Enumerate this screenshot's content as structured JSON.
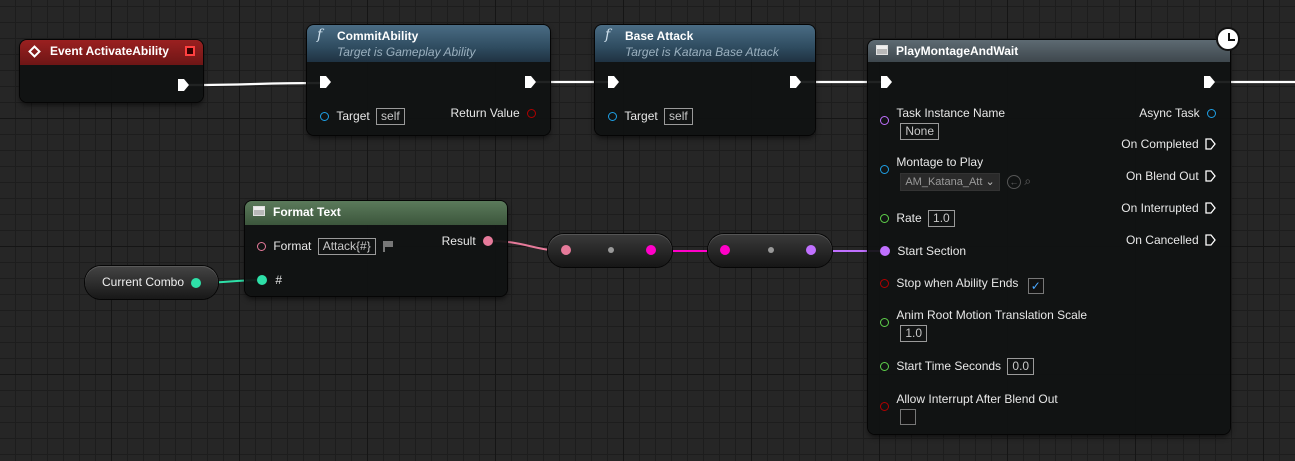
{
  "event_node": {
    "title": "Event ActivateAbility"
  },
  "commit_node": {
    "title": "CommitAbility",
    "subtitle": "Target is Gameplay Ability",
    "target_label": "Target",
    "target_value": "self",
    "return_label": "Return Value"
  },
  "base_attack_node": {
    "title": "Base Attack",
    "subtitle": "Target is Katana Base Attack",
    "target_label": "Target",
    "target_value": "self"
  },
  "format_text_node": {
    "title": "Format Text",
    "format_label": "Format",
    "format_value": "Attack{#}",
    "result_label": "Result",
    "hash_label": "#"
  },
  "current_combo_node": {
    "label": "Current Combo"
  },
  "montage_node": {
    "title": "PlayMontageAndWait",
    "task_instance_label": "Task Instance Name",
    "task_instance_value": "None",
    "montage_label": "Montage to Play",
    "montage_value": "AM_Katana_Att",
    "rate_label": "Rate",
    "rate_value": "1.0",
    "start_section_label": "Start Section",
    "stop_label": "Stop when Ability Ends",
    "stop_checked": "✓",
    "anim_root_label": "Anim Root Motion Translation Scale",
    "anim_root_value": "1.0",
    "start_time_label": "Start Time Seconds",
    "start_time_value": "0.0",
    "allow_interrupt_label": "Allow Interrupt After Blend Out",
    "outputs": {
      "async_task": "Async Task",
      "on_completed": "On Completed",
      "on_blend_out": "On Blend Out",
      "on_interrupted": "On Interrupted",
      "on_cancelled": "On Cancelled"
    }
  },
  "colors": {
    "exec": "#ffffff",
    "object": "#1ea0e6",
    "text": "#e67a9a",
    "int": "#2ee0a8",
    "float": "#5ed04a",
    "name": "#c070ff",
    "bool": "#960000",
    "string": "#ff00c8"
  },
  "icons": {
    "clock": "clock-icon",
    "event": "event-diamond-icon",
    "function": "function-icon",
    "task": "task-node-icon",
    "flag": "flag-icon",
    "browse": "browse-arrow-icon",
    "search": "search-icon",
    "chevron": "chevron-down-icon",
    "checkmark": "checkmark-icon"
  }
}
